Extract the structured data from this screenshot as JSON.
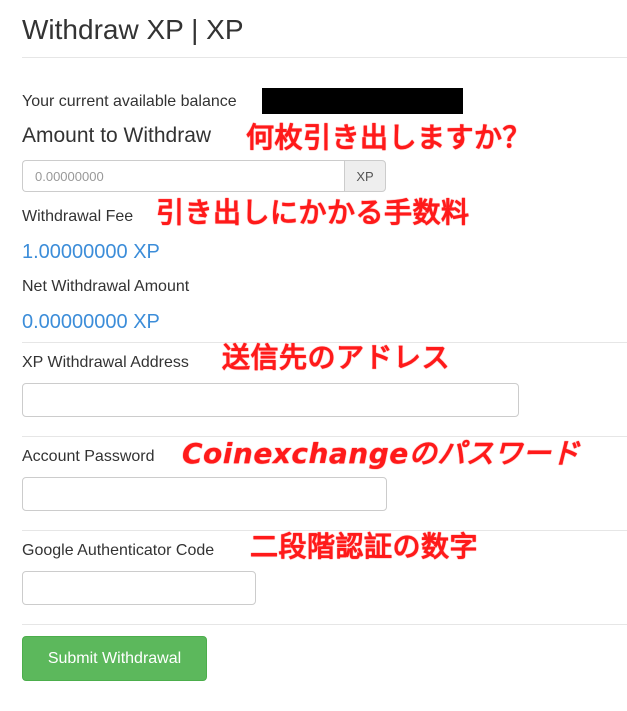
{
  "page": {
    "title": "Withdraw XP | XP"
  },
  "balance": {
    "label": "Your current available balance"
  },
  "amount": {
    "label": "Amount to Withdraw",
    "annotation": "何枚引き出しますか？",
    "placeholder": "0.00000000",
    "unit": "XP"
  },
  "fee": {
    "label": "Withdrawal Fee",
    "annotation": "引き出しにかかる手数料",
    "value": "1.00000000 XP"
  },
  "net": {
    "label": "Net Withdrawal Amount",
    "value": "0.00000000 XP"
  },
  "address": {
    "label": "XP Withdrawal Address",
    "annotation": "送信先のアドレス"
  },
  "password": {
    "label": "Account Password",
    "annotation": "Coinexchangeのパスワード"
  },
  "authenticator": {
    "label": "Google Authenticator Code",
    "annotation": "二段階認証の数字"
  },
  "submit": {
    "label": "Submit Withdrawal"
  },
  "colors": {
    "annotation": "#ff1a1a",
    "value_blue": "#3c8dd9",
    "submit_green": "#5cb85c"
  }
}
